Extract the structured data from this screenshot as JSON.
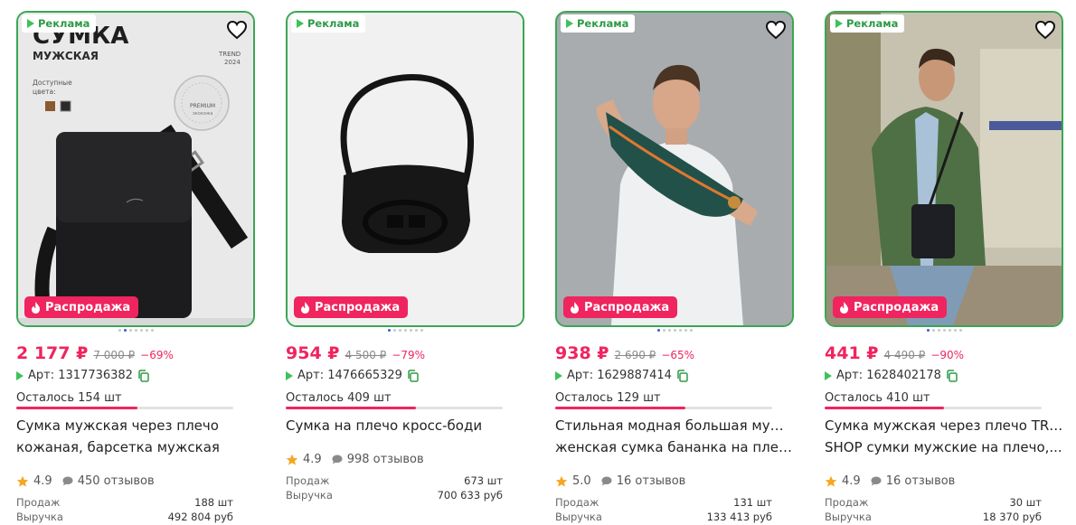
{
  "ad_label": "Реклама",
  "sale_label": "Распродажа",
  "products": [
    {
      "price": "2 177 ₽",
      "old_price": "7 000 ₽",
      "discount": "−69%",
      "article": "Арт: 1317736382",
      "left": "Осталось 154 шт",
      "stock_fill": 0.56,
      "title_line1": "Сумка мужская через плечо",
      "title_line2": "кожаная, барсетка мужская",
      "rating": "4.9",
      "reviews": "450 отзывов",
      "sales_label": "Продаж",
      "sales": "188 шт",
      "revenue_label": "Выручка",
      "revenue": "492 804 руб",
      "photo_text": {
        "headline": "СУМКА",
        "sub": "МУЖСКАЯ",
        "trend": "TREND",
        "year": "2024",
        "colors": "Доступные",
        "colors2": "цвета:",
        "seal": "PREMIUM",
        "seal2": "экокожа"
      }
    },
    {
      "price": "954 ₽",
      "old_price": "4 500 ₽",
      "discount": "−79%",
      "article": "Арт: 1476665329",
      "left": "Осталось 409 шт",
      "stock_fill": 0.6,
      "title_line1": "Сумка на плечо кросс-боди",
      "title_line2": "",
      "rating": "4.9",
      "reviews": "998 отзывов",
      "sales_label": "Продаж",
      "sales": "673 шт",
      "revenue_label": "Выручка",
      "revenue": "700 633 руб"
    },
    {
      "price": "938 ₽",
      "old_price": "2 690 ₽",
      "discount": "−65%",
      "article": "Арт: 1629887414",
      "left": "Осталось 129 шт",
      "stock_fill": 0.6,
      "title_line1": "Стильная модная большая мужская",
      "title_line2": "женская сумка бананка на плечо,...",
      "rating": "5.0",
      "reviews": "16 отзывов",
      "sales_label": "Продаж",
      "sales": "131 шт",
      "revenue_label": "Выручка",
      "revenue": "133 413 руб"
    },
    {
      "price": "441 ₽",
      "old_price": "4 490 ₽",
      "discount": "−90%",
      "article": "Арт: 1628402178",
      "left": "Осталось 410 шт",
      "stock_fill": 0.55,
      "title_line1": "Сумка мужская через плечо TRUE",
      "title_line2": "SHOP сумки мужские на плечо,...",
      "rating": "4.9",
      "reviews": "16 отзывов",
      "sales_label": "Продаж",
      "sales": "30 шт",
      "revenue_label": "Выручка",
      "revenue": "18 370 руб"
    }
  ],
  "colors": {
    "accent": "#f0245f",
    "border": "#3aa655",
    "ad_green": "#3ec15a",
    "star": "#f5a623"
  },
  "icons": [
    "heart-icon",
    "flame-icon",
    "ad-triangle-icon",
    "copy-icon",
    "star-icon",
    "comment-icon"
  ]
}
